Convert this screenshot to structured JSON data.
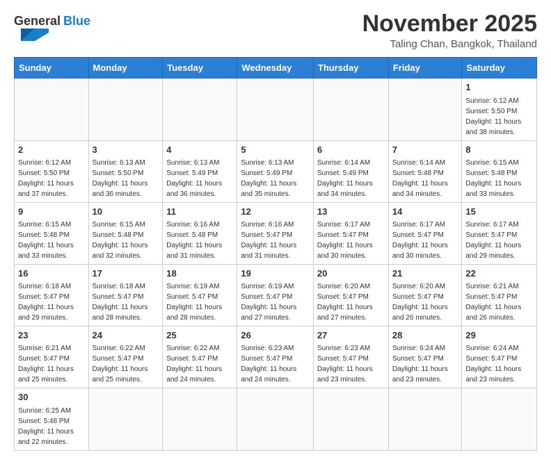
{
  "header": {
    "logo_general": "General",
    "logo_blue": "Blue",
    "month": "November 2025",
    "location": "Taling Chan, Bangkok, Thailand"
  },
  "weekdays": [
    "Sunday",
    "Monday",
    "Tuesday",
    "Wednesday",
    "Thursday",
    "Friday",
    "Saturday"
  ],
  "weeks": [
    [
      {
        "day": "",
        "sunrise": "",
        "sunset": "",
        "daylight": ""
      },
      {
        "day": "",
        "sunrise": "",
        "sunset": "",
        "daylight": ""
      },
      {
        "day": "",
        "sunrise": "",
        "sunset": "",
        "daylight": ""
      },
      {
        "day": "",
        "sunrise": "",
        "sunset": "",
        "daylight": ""
      },
      {
        "day": "",
        "sunrise": "",
        "sunset": "",
        "daylight": ""
      },
      {
        "day": "",
        "sunrise": "",
        "sunset": "",
        "daylight": ""
      },
      {
        "day": "1",
        "sunrise": "Sunrise: 6:12 AM",
        "sunset": "Sunset: 5:50 PM",
        "daylight": "Daylight: 11 hours and 38 minutes."
      }
    ],
    [
      {
        "day": "2",
        "sunrise": "Sunrise: 6:12 AM",
        "sunset": "Sunset: 5:50 PM",
        "daylight": "Daylight: 11 hours and 37 minutes."
      },
      {
        "day": "3",
        "sunrise": "Sunrise: 6:13 AM",
        "sunset": "Sunset: 5:50 PM",
        "daylight": "Daylight: 11 hours and 36 minutes."
      },
      {
        "day": "4",
        "sunrise": "Sunrise: 6:13 AM",
        "sunset": "Sunset: 5:49 PM",
        "daylight": "Daylight: 11 hours and 36 minutes."
      },
      {
        "day": "5",
        "sunrise": "Sunrise: 6:13 AM",
        "sunset": "Sunset: 5:49 PM",
        "daylight": "Daylight: 11 hours and 35 minutes."
      },
      {
        "day": "6",
        "sunrise": "Sunrise: 6:14 AM",
        "sunset": "Sunset: 5:49 PM",
        "daylight": "Daylight: 11 hours and 34 minutes."
      },
      {
        "day": "7",
        "sunrise": "Sunrise: 6:14 AM",
        "sunset": "Sunset: 5:48 PM",
        "daylight": "Daylight: 11 hours and 34 minutes."
      },
      {
        "day": "8",
        "sunrise": "Sunrise: 6:15 AM",
        "sunset": "Sunset: 5:48 PM",
        "daylight": "Daylight: 11 hours and 33 minutes."
      }
    ],
    [
      {
        "day": "9",
        "sunrise": "Sunrise: 6:15 AM",
        "sunset": "Sunset: 5:48 PM",
        "daylight": "Daylight: 11 hours and 33 minutes."
      },
      {
        "day": "10",
        "sunrise": "Sunrise: 6:15 AM",
        "sunset": "Sunset: 5:48 PM",
        "daylight": "Daylight: 11 hours and 32 minutes."
      },
      {
        "day": "11",
        "sunrise": "Sunrise: 6:16 AM",
        "sunset": "Sunset: 5:48 PM",
        "daylight": "Daylight: 11 hours and 31 minutes."
      },
      {
        "day": "12",
        "sunrise": "Sunrise: 6:16 AM",
        "sunset": "Sunset: 5:47 PM",
        "daylight": "Daylight: 11 hours and 31 minutes."
      },
      {
        "day": "13",
        "sunrise": "Sunrise: 6:17 AM",
        "sunset": "Sunset: 5:47 PM",
        "daylight": "Daylight: 11 hours and 30 minutes."
      },
      {
        "day": "14",
        "sunrise": "Sunrise: 6:17 AM",
        "sunset": "Sunset: 5:47 PM",
        "daylight": "Daylight: 11 hours and 30 minutes."
      },
      {
        "day": "15",
        "sunrise": "Sunrise: 6:17 AM",
        "sunset": "Sunset: 5:47 PM",
        "daylight": "Daylight: 11 hours and 29 minutes."
      }
    ],
    [
      {
        "day": "16",
        "sunrise": "Sunrise: 6:18 AM",
        "sunset": "Sunset: 5:47 PM",
        "daylight": "Daylight: 11 hours and 29 minutes."
      },
      {
        "day": "17",
        "sunrise": "Sunrise: 6:18 AM",
        "sunset": "Sunset: 5:47 PM",
        "daylight": "Daylight: 11 hours and 28 minutes."
      },
      {
        "day": "18",
        "sunrise": "Sunrise: 6:19 AM",
        "sunset": "Sunset: 5:47 PM",
        "daylight": "Daylight: 11 hours and 28 minutes."
      },
      {
        "day": "19",
        "sunrise": "Sunrise: 6:19 AM",
        "sunset": "Sunset: 5:47 PM",
        "daylight": "Daylight: 11 hours and 27 minutes."
      },
      {
        "day": "20",
        "sunrise": "Sunrise: 6:20 AM",
        "sunset": "Sunset: 5:47 PM",
        "daylight": "Daylight: 11 hours and 27 minutes."
      },
      {
        "day": "21",
        "sunrise": "Sunrise: 6:20 AM",
        "sunset": "Sunset: 5:47 PM",
        "daylight": "Daylight: 11 hours and 26 minutes."
      },
      {
        "day": "22",
        "sunrise": "Sunrise: 6:21 AM",
        "sunset": "Sunset: 5:47 PM",
        "daylight": "Daylight: 11 hours and 26 minutes."
      }
    ],
    [
      {
        "day": "23",
        "sunrise": "Sunrise: 6:21 AM",
        "sunset": "Sunset: 5:47 PM",
        "daylight": "Daylight: 11 hours and 25 minutes."
      },
      {
        "day": "24",
        "sunrise": "Sunrise: 6:22 AM",
        "sunset": "Sunset: 5:47 PM",
        "daylight": "Daylight: 11 hours and 25 minutes."
      },
      {
        "day": "25",
        "sunrise": "Sunrise: 6:22 AM",
        "sunset": "Sunset: 5:47 PM",
        "daylight": "Daylight: 11 hours and 24 minutes."
      },
      {
        "day": "26",
        "sunrise": "Sunrise: 6:23 AM",
        "sunset": "Sunset: 5:47 PM",
        "daylight": "Daylight: 11 hours and 24 minutes."
      },
      {
        "day": "27",
        "sunrise": "Sunrise: 6:23 AM",
        "sunset": "Sunset: 5:47 PM",
        "daylight": "Daylight: 11 hours and 23 minutes."
      },
      {
        "day": "28",
        "sunrise": "Sunrise: 6:24 AM",
        "sunset": "Sunset: 5:47 PM",
        "daylight": "Daylight: 11 hours and 23 minutes."
      },
      {
        "day": "29",
        "sunrise": "Sunrise: 6:24 AM",
        "sunset": "Sunset: 5:47 PM",
        "daylight": "Daylight: 11 hours and 23 minutes."
      }
    ],
    [
      {
        "day": "30",
        "sunrise": "Sunrise: 6:25 AM",
        "sunset": "Sunset: 5:48 PM",
        "daylight": "Daylight: 11 hours and 22 minutes."
      },
      {
        "day": "",
        "sunrise": "",
        "sunset": "",
        "daylight": ""
      },
      {
        "day": "",
        "sunrise": "",
        "sunset": "",
        "daylight": ""
      },
      {
        "day": "",
        "sunrise": "",
        "sunset": "",
        "daylight": ""
      },
      {
        "day": "",
        "sunrise": "",
        "sunset": "",
        "daylight": ""
      },
      {
        "day": "",
        "sunrise": "",
        "sunset": "",
        "daylight": ""
      },
      {
        "day": "",
        "sunrise": "",
        "sunset": "",
        "daylight": ""
      }
    ]
  ]
}
